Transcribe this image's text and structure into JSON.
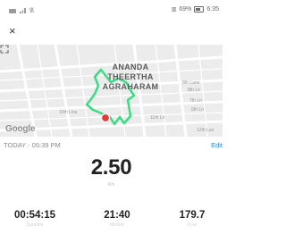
{
  "status_bar": {
    "battery": "69%",
    "time": "6:35"
  },
  "header": {
    "close_label": "×"
  },
  "map": {
    "area_label_lines": [
      "ANANDA",
      "THEERTHA",
      "AGRAHARAM"
    ],
    "streets": [
      "8th Lane",
      "8th Ln",
      "7th Ln",
      "6th Ln",
      "10th Line",
      "11th Ln",
      "12th Lan"
    ],
    "attribution": "Google",
    "route_color": "#3ddc84",
    "marker_color": "#e53935",
    "expand_icon": "expand-icon"
  },
  "activity": {
    "date": "TODAY - 05:39 PM",
    "edit_label": "Edit",
    "distance": "2.50",
    "distance_unit": "Km",
    "stats": [
      {
        "value": "00:54:15",
        "label": "Duration"
      },
      {
        "value": "21:40",
        "label": "Min/km"
      },
      {
        "value": "179.7",
        "label": "Kcal"
      }
    ]
  }
}
